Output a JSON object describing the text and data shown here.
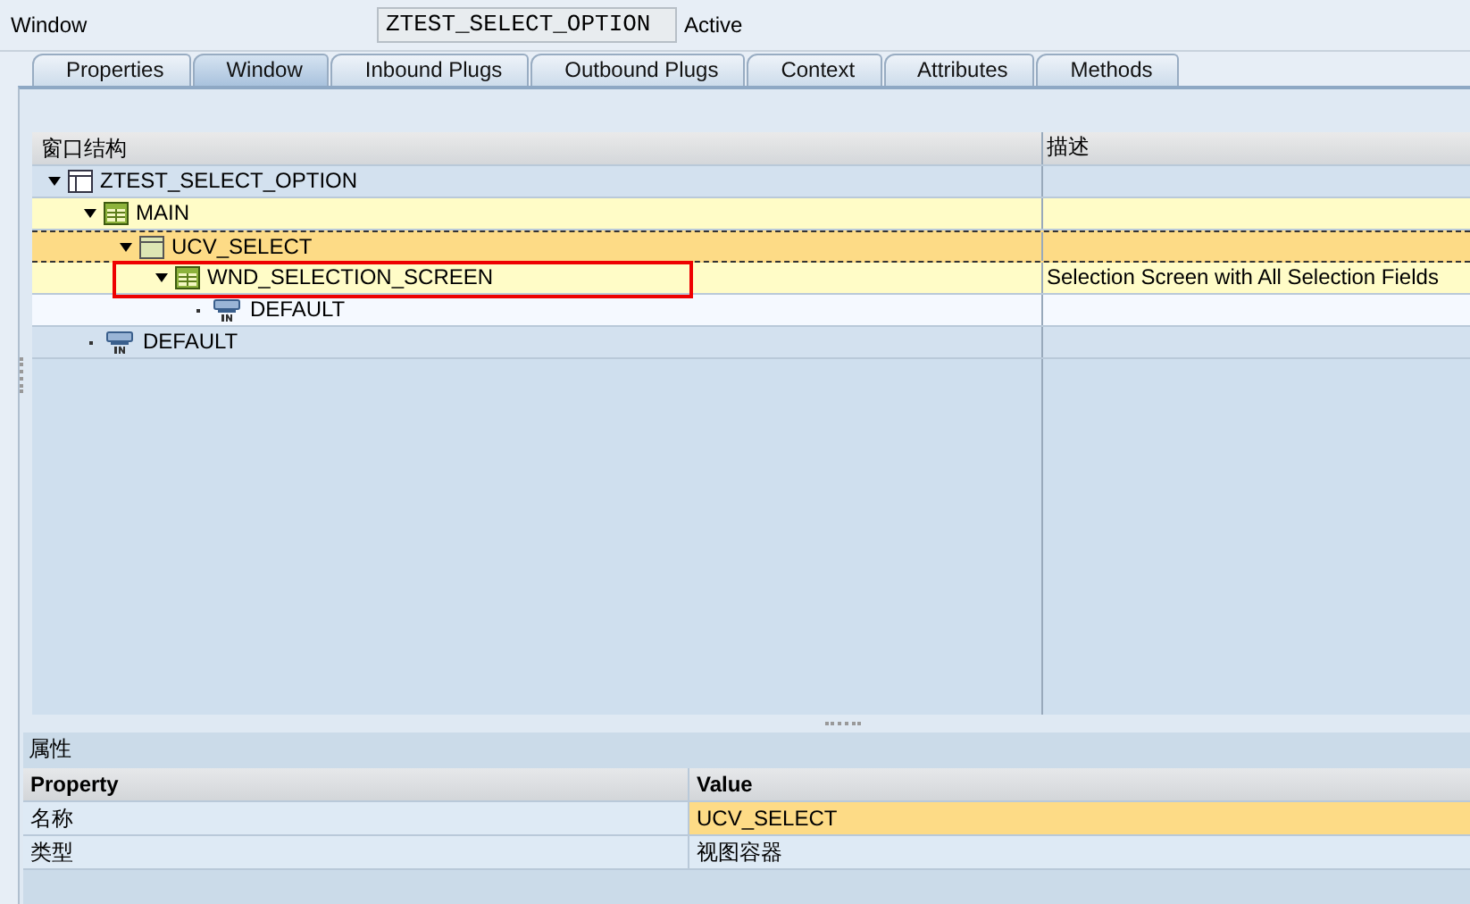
{
  "header": {
    "label": "Window",
    "name": "ZTEST_SELECT_OPTION",
    "status": "Active"
  },
  "tabs": [
    {
      "label": "Properties",
      "selected": false
    },
    {
      "label": "Window",
      "selected": true
    },
    {
      "label": "Inbound Plugs",
      "selected": false
    },
    {
      "label": "Outbound Plugs",
      "selected": false
    },
    {
      "label": "Context",
      "selected": false
    },
    {
      "label": "Attributes",
      "selected": false
    },
    {
      "label": "Methods",
      "selected": false
    }
  ],
  "tree": {
    "columns": [
      "窗口结构",
      "描述"
    ],
    "nodes": [
      {
        "kind": "window",
        "label": "ZTEST_SELECT_OPTION",
        "expanded": true,
        "selected": false,
        "highlighted": false,
        "marked": false,
        "children": [
          {
            "kind": "view",
            "label": "MAIN",
            "expanded": true,
            "selected": false,
            "highlighted": true,
            "marked": false,
            "children": [
              {
                "kind": "container",
                "label": "UCV_SELECT",
                "expanded": true,
                "selected": true,
                "highlighted": false,
                "marked": false,
                "children": [
                  {
                    "kind": "view",
                    "label": "WND_SELECTION_SCREEN",
                    "description": "Selection Screen with All Selection Fields",
                    "expanded": true,
                    "selected": false,
                    "highlighted": true,
                    "marked": true,
                    "children": [
                      {
                        "kind": "plug",
                        "label": "DEFAULT",
                        "expanded": false,
                        "selected": false,
                        "highlighted": false,
                        "marked": false
                      }
                    ]
                  }
                ]
              }
            ]
          },
          {
            "kind": "plug",
            "label": "DEFAULT",
            "expanded": false,
            "selected": false,
            "highlighted": false,
            "marked": false
          }
        ]
      }
    ]
  },
  "properties": {
    "title": "属性",
    "columns": [
      "Property",
      "Value"
    ],
    "rows": [
      {
        "property": "名称",
        "value": "UCV_SELECT",
        "selected": true
      },
      {
        "property": "类型",
        "value": "视图容器",
        "selected": false
      }
    ]
  }
}
